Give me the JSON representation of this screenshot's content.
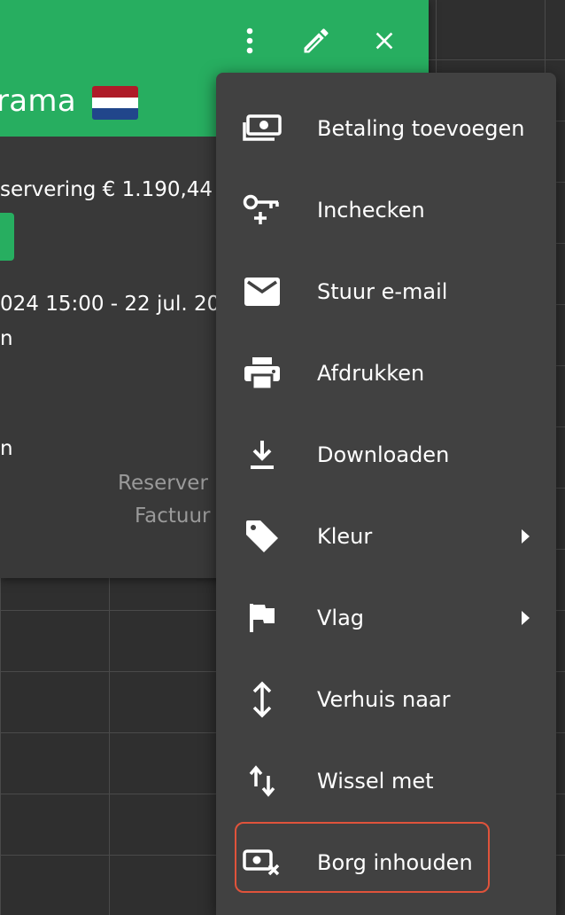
{
  "header": {
    "title_fragment": "rama",
    "flag_colors": [
      "#ae1c28",
      "#ffffff",
      "#21468b"
    ]
  },
  "card": {
    "lines": [
      "servering € 1.190,44",
      "024 15:00 - 22 jul. 20",
      "n",
      "n"
    ],
    "muted_lines": [
      "Reserver",
      "Factuur"
    ]
  },
  "menu": {
    "items": [
      {
        "label": "Betaling toevoegen",
        "icon": "payment-icon"
      },
      {
        "label": "Inchecken",
        "icon": "key-icon"
      },
      {
        "label": "Stuur e-mail",
        "icon": "mail-icon"
      },
      {
        "label": "Afdrukken",
        "icon": "print-icon"
      },
      {
        "label": "Downloaden",
        "icon": "download-icon"
      },
      {
        "label": "Kleur",
        "icon": "tag-icon",
        "submenu": true
      },
      {
        "label": "Vlag",
        "icon": "flag-icon",
        "submenu": true
      },
      {
        "label": "Verhuis naar",
        "icon": "move-icon"
      },
      {
        "label": "Wissel met",
        "icon": "swap-icon"
      },
      {
        "label": "Borg inhouden",
        "icon": "retain-deposit-icon",
        "highlighted": true
      }
    ]
  },
  "colors": {
    "accent_green": "#27ae60",
    "highlight": "#e0533b",
    "menu_bg": "#414141"
  }
}
